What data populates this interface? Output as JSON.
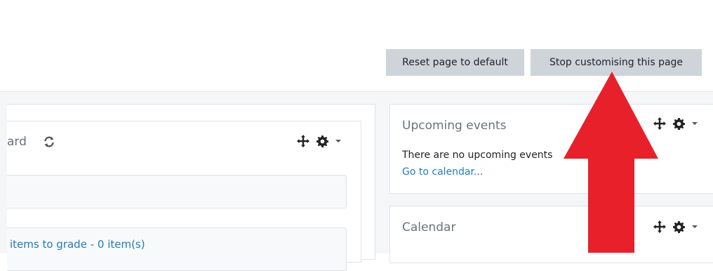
{
  "toolbar": {
    "reset_label": "Reset page to default",
    "stop_label": "Stop customising this page"
  },
  "main": {
    "dashboard_title": "ard",
    "grade_link": "items to grade - 0 item(s)"
  },
  "sidebar": {
    "upcoming": {
      "title": "Upcoming events",
      "empty_text": "There are no upcoming events",
      "calendar_link": "Go to calendar..."
    },
    "calendar": {
      "title": "Calendar"
    }
  },
  "icons": {
    "move": "move-icon",
    "settings": "gear-icon",
    "dropdown": "caret-down-icon",
    "refresh": "refresh-icon"
  },
  "colors": {
    "button_bg": "#ced4da",
    "link": "#1f7bbd",
    "annotation_arrow": "#e8202a"
  }
}
